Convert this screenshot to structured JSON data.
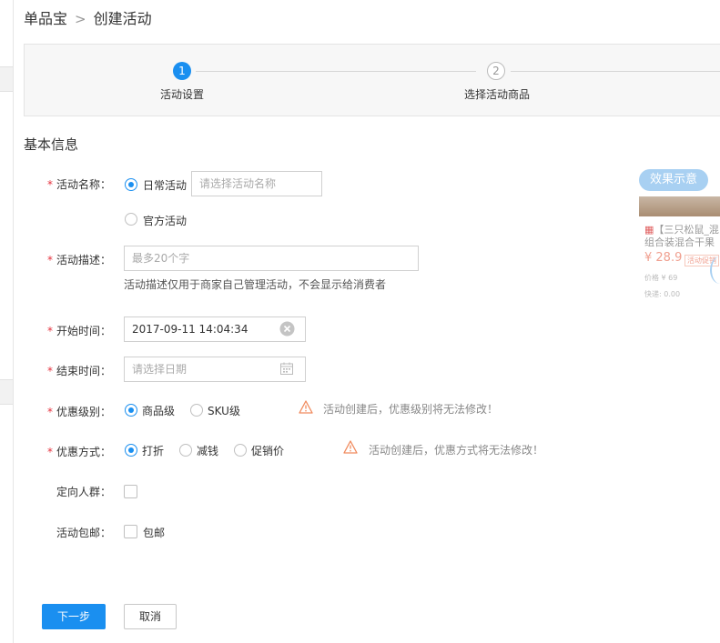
{
  "breadcrumb": {
    "root": "单品宝",
    "separator": ">",
    "current": "创建活动"
  },
  "steps": [
    {
      "number": "1",
      "label": "活动设置",
      "active": true
    },
    {
      "number": "2",
      "label": "选择活动商品",
      "active": false
    }
  ],
  "section_title": "基本信息",
  "form": {
    "activity_name": {
      "label": "活动名称：",
      "options": [
        "日常活动",
        "官方活动"
      ],
      "selected": "日常活动",
      "placeholder": "请选择活动名称"
    },
    "activity_desc": {
      "label": "活动描述：",
      "placeholder": "最多20个字",
      "hint": "活动描述仅用于商家自己管理活动，不会显示给消费者"
    },
    "start_time": {
      "label": "开始时间：",
      "value": "2017-09-11 14:04:34"
    },
    "end_time": {
      "label": "结束时间：",
      "placeholder": "请选择日期"
    },
    "discount_level": {
      "label": "优惠级别：",
      "options": [
        "商品级",
        "SKU级"
      ],
      "selected": "商品级",
      "warning": "活动创建后，优惠级别将无法修改！"
    },
    "discount_method": {
      "label": "优惠方式：",
      "options": [
        "打折",
        "减钱",
        "促销价"
      ],
      "selected": "打折",
      "warning": "活动创建后，优惠方式将无法修改！"
    },
    "target_crowd": {
      "label": "定向人群：",
      "checked": false
    },
    "free_shipping": {
      "label": "活动包邮：",
      "option": "包邮",
      "checked": false
    }
  },
  "buttons": {
    "next": "下一步",
    "cancel": "取消"
  },
  "preview": {
    "badge": "效果示意",
    "title_line1": "【三只松鼠_混",
    "title_line2": "组合装混合干果",
    "price": "¥ 28.9",
    "tag": "活动促销",
    "orig_price": "价格 ¥ 69",
    "shipping": "快递: 0.00"
  },
  "colors": {
    "primary": "#1a8ff0",
    "required": "#e5323e",
    "warning": "#f08a5d"
  }
}
